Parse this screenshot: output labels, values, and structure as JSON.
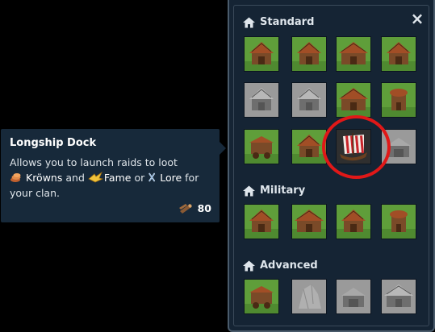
{
  "tooltip": {
    "title": "Longship Dock",
    "line1": "Allows you to launch raids to loot",
    "resource1": "Kröwns",
    "and": "and",
    "resource2": "Fame",
    "or": "or",
    "resource3": "Lore",
    "for": "for",
    "line3": "your clan.",
    "cost_value": "80",
    "cost_icon": "wood-log-icon"
  },
  "panel": {
    "close_label": "×",
    "sections": [
      {
        "title": "Standard",
        "icon": "home-icon"
      },
      {
        "title": "Military",
        "icon": "home-icon"
      },
      {
        "title": "Advanced",
        "icon": "home-icon"
      }
    ]
  },
  "colors": {
    "panel_bg": "#152434",
    "tooltip_bg": "#17293a",
    "highlight": "#e01818",
    "grass": "#5f9e3a",
    "roof": "#a14e26",
    "locked_gray": "#8a8a8a"
  },
  "buildings": {
    "standard": [
      {
        "kind": "house",
        "state": "available"
      },
      {
        "kind": "workshop",
        "state": "available"
      },
      {
        "kind": "hall",
        "state": "available"
      },
      {
        "kind": "barn",
        "state": "available"
      },
      {
        "kind": "house",
        "state": "locked"
      },
      {
        "kind": "workshop",
        "state": "locked"
      },
      {
        "kind": "hall",
        "state": "available"
      },
      {
        "kind": "tower",
        "state": "available"
      },
      {
        "kind": "cart",
        "state": "available"
      },
      {
        "kind": "market",
        "state": "available"
      },
      {
        "kind": "longship",
        "state": "selected"
      },
      {
        "kind": "forge",
        "state": "locked"
      }
    ],
    "military": [
      {
        "kind": "tent",
        "state": "available"
      },
      {
        "kind": "hall",
        "state": "available"
      },
      {
        "kind": "armory",
        "state": "available"
      },
      {
        "kind": "tower",
        "state": "available"
      }
    ],
    "advanced": [
      {
        "kind": "cart",
        "state": "available"
      },
      {
        "kind": "rock",
        "state": "locked"
      },
      {
        "kind": "forge",
        "state": "locked"
      },
      {
        "kind": "hall",
        "state": "locked"
      }
    ]
  }
}
